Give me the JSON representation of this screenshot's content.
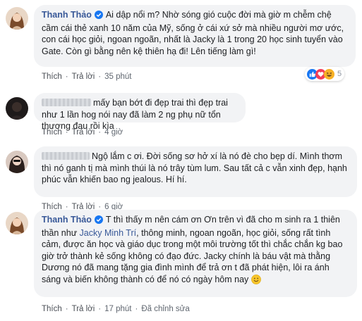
{
  "comments": [
    {
      "author": "Thanh Thảo",
      "verified": true,
      "text": "Ai dập nổi m? Nhờ sóng gió cuộc đời mà giờ m chễm chệ cầm cái thẻ xanh 10 năm của Mỹ, sống ở cái xứ sở mà nhiều người mơ ước, con cái học giỏi, ngoan ngoãn, nhất là Jacky là 1 trong 20 học sinh tuyển vào Gate. Còn gì bằng nên kệ thiên hạ đi! Lên tiếng làm gì!",
      "like": "Thích",
      "reply": "Trả lời",
      "time": "35 phút",
      "reaction_count": "5",
      "reaction_icons": [
        "like-icon",
        "love-icon",
        "haha-icon"
      ]
    },
    {
      "author_hidden": true,
      "text": "mấy bạn bớt đi đẹp trai thì đẹp trai như 1 lần hog nói nay đã làm 2 ng phụ nữ tổn thương đau rồi kìa",
      "like": "Thích",
      "reply": "Trả lời",
      "time": "4 giờ"
    },
    {
      "author_hidden": true,
      "text": "Ngộ lắm c ơi. Đời sống sơ hở xí là nó đè cho bẹp dí. Mình thơm thì nó ganh tị mà mình thúi là nó trây tùm lum. Sau tất cả c vẫn xinh đẹp, hạnh phúc vẫn khiến bao ng jealous. Hí hí.",
      "like": "Thích",
      "reply": "Trả lời",
      "time": "6 giờ"
    },
    {
      "author": "Thanh Thảo",
      "verified": true,
      "text_before": "T thì thấy m nên cám ơn Ơn trên vì đã cho m sinh ra 1 thiên thần như ",
      "mention": "Jacky Minh Trí",
      "text_after": ", thông minh, ngoan ngoãn, học giỏi, sống rất tình cảm, được ăn học và giáo dục trong một môi trường tốt thì chắc chắn kg bao giờ trở thành kẻ sống không có đạo đức. Jacky chính là báu vật mà thằng Dương nó đã mang tặng gia đình mình để trả ơn t đã phát hiện, lôi ra ánh sáng và biến không thành có để nó có ngày hôm nay",
      "emoji": "smile-emoji",
      "like": "Thích",
      "reply": "Trả lời",
      "time": "17 phút",
      "edited": "Đã chỉnh sửa"
    }
  ],
  "colors": {
    "link": "#385898",
    "bubble": "#f2f3f5",
    "meta": "#606770",
    "like_blue": "#1877f2"
  }
}
